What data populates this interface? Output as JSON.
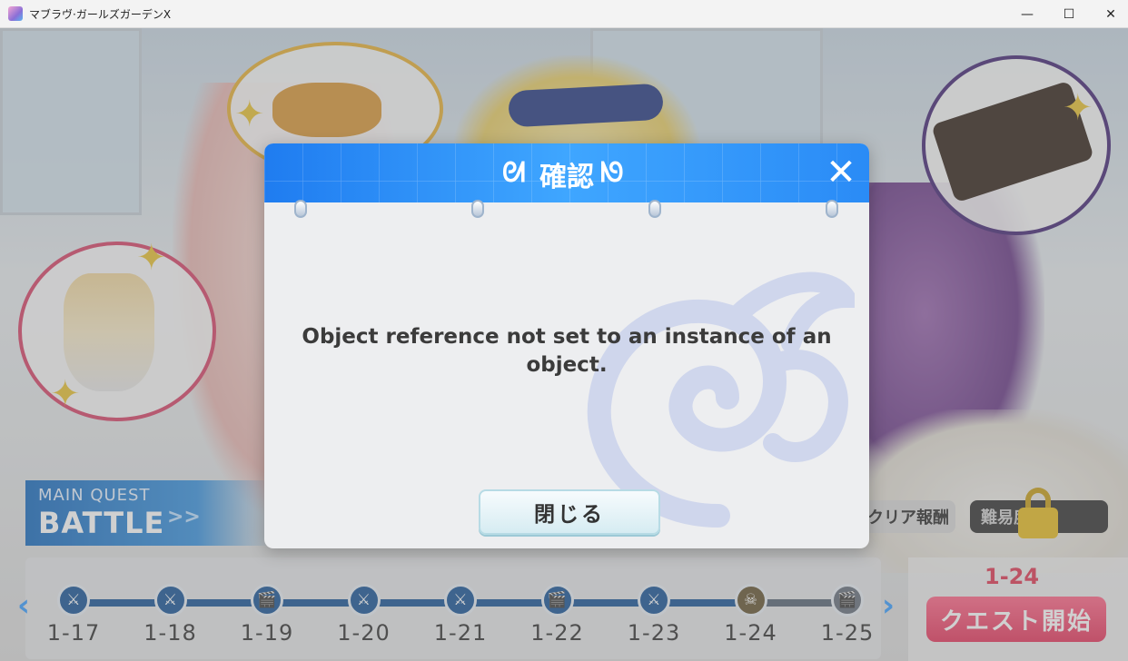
{
  "window": {
    "title": "マブラヴ·ガールズガーデンX",
    "minimize_glyph": "—",
    "maximize_glyph": "☐",
    "close_glyph": "✕"
  },
  "background": {
    "quest_panel": {
      "subtitle": "MAIN QUEST",
      "title": "BATTLE",
      "arrows": ">>"
    },
    "clear_reward_label": "クリア報酬",
    "difficulty_label": "難易度",
    "stage_nav": {
      "prev": "‹",
      "next": "›"
    },
    "stages": [
      {
        "label": "1-17",
        "icon": "swords-icon",
        "glyph": "⚔",
        "state": "cleared"
      },
      {
        "label": "1-18",
        "icon": "swords-icon",
        "glyph": "⚔",
        "state": "cleared"
      },
      {
        "label": "1-19",
        "icon": "clapperboard-icon",
        "glyph": "🎬",
        "state": "cleared"
      },
      {
        "label": "1-20",
        "icon": "swords-icon",
        "glyph": "⚔",
        "state": "cleared"
      },
      {
        "label": "1-21",
        "icon": "swords-icon",
        "glyph": "⚔",
        "state": "cleared"
      },
      {
        "label": "1-22",
        "icon": "clapperboard-icon",
        "glyph": "🎬",
        "state": "cleared"
      },
      {
        "label": "1-23",
        "icon": "swords-icon",
        "glyph": "⚔",
        "state": "cleared"
      },
      {
        "label": "1-24",
        "icon": "boss-icon",
        "glyph": "☠",
        "state": "current"
      },
      {
        "label": "1-25",
        "icon": "clapperboard-icon",
        "glyph": "🎬",
        "state": "locked"
      }
    ],
    "selected_stage": "1-24",
    "start_button": "クエスト開始"
  },
  "dialog": {
    "title": "確認",
    "close_glyph": "✕",
    "message": "Object reference not set to an instance of an object.",
    "button_label": "閉じる"
  },
  "colors": {
    "dialog_header": "#2a8bf6",
    "dialog_body": "#edeef0",
    "start_button": "#e63d62",
    "stage_line": "#1f5a9a"
  }
}
